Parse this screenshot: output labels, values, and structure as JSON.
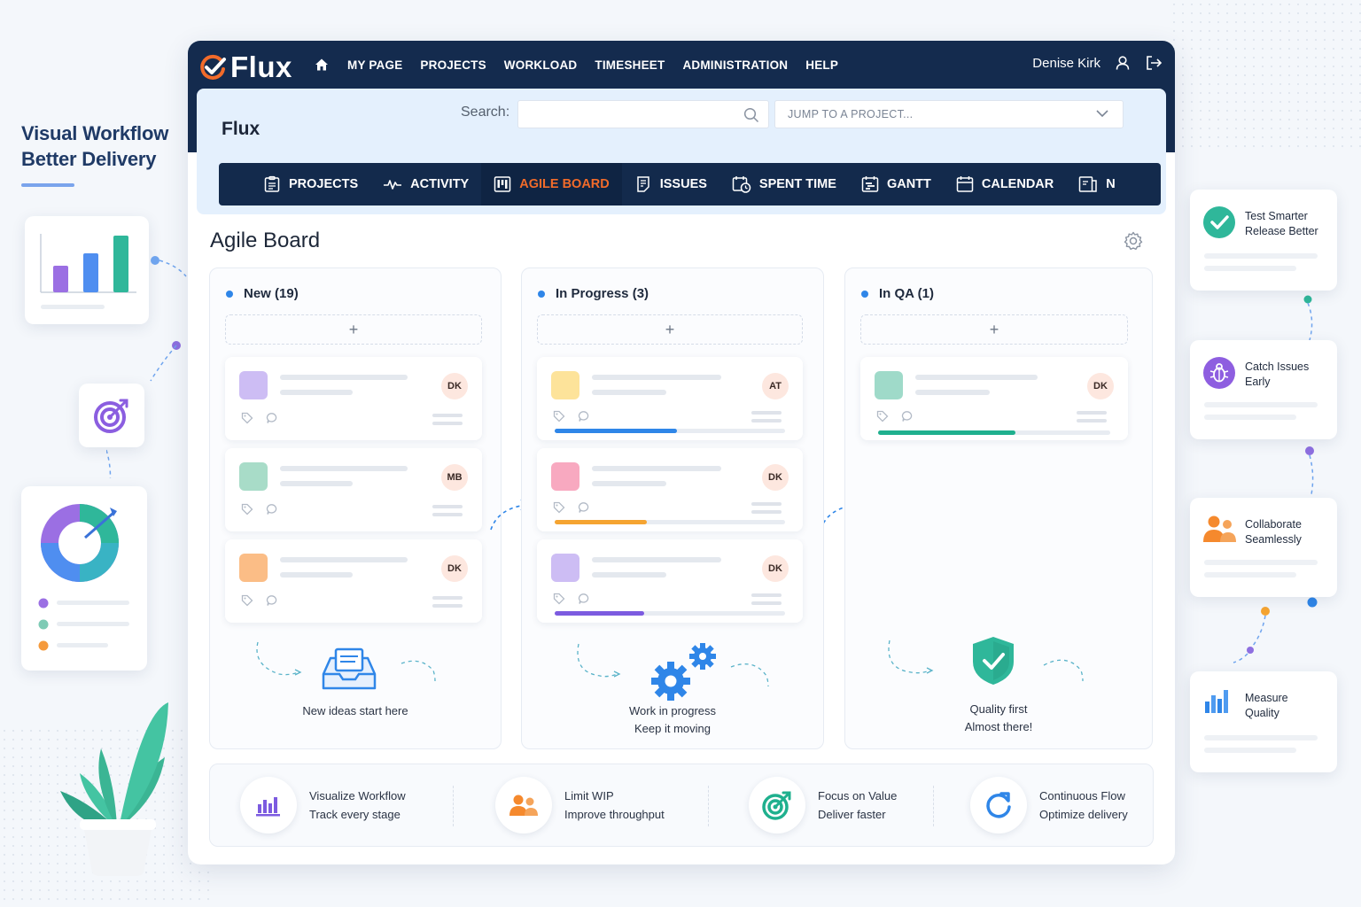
{
  "tagline": {
    "line1": "Visual Workflow",
    "line2": "Better Delivery"
  },
  "app": {
    "logo_text": "Flux",
    "nav": [
      "MY PAGE",
      "PROJECTS",
      "WORKLOAD",
      "TIMESHEET",
      "ADMINISTRATION",
      "HELP"
    ],
    "user_name": "Denise Kirk"
  },
  "project": {
    "title": "Flux",
    "search_label": "Search:",
    "search_value": "",
    "jump_placeholder": "JUMP TO A PROJECT..."
  },
  "tabs": [
    {
      "label": "PROJECTS",
      "icon": "projects-icon",
      "active": false
    },
    {
      "label": "ACTIVITY",
      "icon": "activity-icon",
      "active": false
    },
    {
      "label": "AGILE BOARD",
      "icon": "board-icon",
      "active": true
    },
    {
      "label": "ISSUES",
      "icon": "issues-icon",
      "active": false
    },
    {
      "label": "SPENT TIME",
      "icon": "spent-time-icon",
      "active": false
    },
    {
      "label": "GANTT",
      "icon": "gantt-icon",
      "active": false
    },
    {
      "label": "CALENDAR",
      "icon": "calendar-icon",
      "active": false
    },
    {
      "label": "N",
      "icon": "news-icon",
      "active": false
    }
  ],
  "board": {
    "title": "Agile Board",
    "add_label": "+",
    "columns": [
      {
        "title": "New (19)",
        "caption1": "New ideas start here",
        "caption2": "",
        "cards": [
          {
            "initials": "DK",
            "color": "#cdbdf4"
          },
          {
            "initials": "MB",
            "color": "#a8dcc8"
          },
          {
            "initials": "DK",
            "color": "#fbbd86"
          }
        ]
      },
      {
        "title": "In Progress (3)",
        "caption1": "Work in progress",
        "caption2": "Keep it moving",
        "cards": [
          {
            "initials": "AT",
            "color": "#fde39a",
            "progress": 0.53,
            "bar_color": "#2f86e8"
          },
          {
            "initials": "DK",
            "color": "#f8a9c0",
            "progress": 0.4,
            "bar_color": "#f5a431"
          },
          {
            "initials": "DK",
            "color": "#cdbdf4",
            "progress": 0.39,
            "bar_color": "#7c5be0"
          }
        ]
      },
      {
        "title": "In QA (1)",
        "caption1": "Quality first",
        "caption2": "Almost there!",
        "cards": [
          {
            "initials": "DK",
            "color": "#9fdac9",
            "progress": 0.59,
            "bar_color": "#1fb08e"
          }
        ]
      }
    ]
  },
  "features": [
    {
      "line1": "Visualize Workflow",
      "line2": "Track every stage",
      "icon": "bar-chart-icon"
    },
    {
      "line1": "Limit WIP",
      "line2": "Improve throughput",
      "icon": "team-icon"
    },
    {
      "line1": "Focus on Value",
      "line2": "Deliver faster",
      "icon": "target-icon"
    },
    {
      "line1": "Continuous Flow",
      "line2": "Optimize delivery",
      "icon": "refresh-icon"
    }
  ],
  "side_cards": [
    {
      "line1": "Test Smarter",
      "line2": "Release Better",
      "icon": "check-circle-icon"
    },
    {
      "line1": "Catch Issues",
      "line2": "Early",
      "icon": "bug-icon"
    },
    {
      "line1": "Collaborate",
      "line2": "Seamlessly",
      "icon": "people-icon"
    },
    {
      "line1": "Measure",
      "line2": "Quality",
      "icon": "bar-chart-icon"
    }
  ],
  "colors": {
    "navy": "#142b4e",
    "accent": "#f26b2a",
    "header_bg": "#e4f0fd",
    "column_dot": "#2f86e8"
  }
}
